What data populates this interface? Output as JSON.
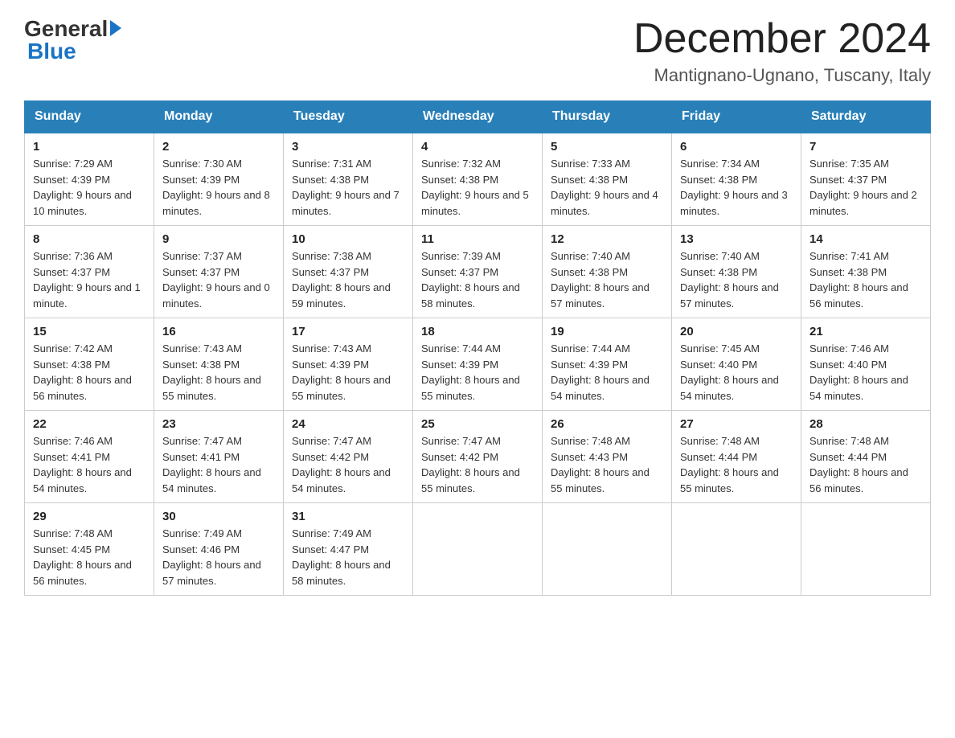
{
  "logo": {
    "general": "General",
    "blue": "Blue"
  },
  "title": "December 2024",
  "location": "Mantignano-Ugnano, Tuscany, Italy",
  "days_of_week": [
    "Sunday",
    "Monday",
    "Tuesday",
    "Wednesday",
    "Thursday",
    "Friday",
    "Saturday"
  ],
  "weeks": [
    [
      {
        "day": "1",
        "sunrise": "7:29 AM",
        "sunset": "4:39 PM",
        "daylight": "9 hours and 10 minutes."
      },
      {
        "day": "2",
        "sunrise": "7:30 AM",
        "sunset": "4:39 PM",
        "daylight": "9 hours and 8 minutes."
      },
      {
        "day": "3",
        "sunrise": "7:31 AM",
        "sunset": "4:38 PM",
        "daylight": "9 hours and 7 minutes."
      },
      {
        "day": "4",
        "sunrise": "7:32 AM",
        "sunset": "4:38 PM",
        "daylight": "9 hours and 5 minutes."
      },
      {
        "day": "5",
        "sunrise": "7:33 AM",
        "sunset": "4:38 PM",
        "daylight": "9 hours and 4 minutes."
      },
      {
        "day": "6",
        "sunrise": "7:34 AM",
        "sunset": "4:38 PM",
        "daylight": "9 hours and 3 minutes."
      },
      {
        "day": "7",
        "sunrise": "7:35 AM",
        "sunset": "4:37 PM",
        "daylight": "9 hours and 2 minutes."
      }
    ],
    [
      {
        "day": "8",
        "sunrise": "7:36 AM",
        "sunset": "4:37 PM",
        "daylight": "9 hours and 1 minute."
      },
      {
        "day": "9",
        "sunrise": "7:37 AM",
        "sunset": "4:37 PM",
        "daylight": "9 hours and 0 minutes."
      },
      {
        "day": "10",
        "sunrise": "7:38 AM",
        "sunset": "4:37 PM",
        "daylight": "8 hours and 59 minutes."
      },
      {
        "day": "11",
        "sunrise": "7:39 AM",
        "sunset": "4:37 PM",
        "daylight": "8 hours and 58 minutes."
      },
      {
        "day": "12",
        "sunrise": "7:40 AM",
        "sunset": "4:38 PM",
        "daylight": "8 hours and 57 minutes."
      },
      {
        "day": "13",
        "sunrise": "7:40 AM",
        "sunset": "4:38 PM",
        "daylight": "8 hours and 57 minutes."
      },
      {
        "day": "14",
        "sunrise": "7:41 AM",
        "sunset": "4:38 PM",
        "daylight": "8 hours and 56 minutes."
      }
    ],
    [
      {
        "day": "15",
        "sunrise": "7:42 AM",
        "sunset": "4:38 PM",
        "daylight": "8 hours and 56 minutes."
      },
      {
        "day": "16",
        "sunrise": "7:43 AM",
        "sunset": "4:38 PM",
        "daylight": "8 hours and 55 minutes."
      },
      {
        "day": "17",
        "sunrise": "7:43 AM",
        "sunset": "4:39 PM",
        "daylight": "8 hours and 55 minutes."
      },
      {
        "day": "18",
        "sunrise": "7:44 AM",
        "sunset": "4:39 PM",
        "daylight": "8 hours and 55 minutes."
      },
      {
        "day": "19",
        "sunrise": "7:44 AM",
        "sunset": "4:39 PM",
        "daylight": "8 hours and 54 minutes."
      },
      {
        "day": "20",
        "sunrise": "7:45 AM",
        "sunset": "4:40 PM",
        "daylight": "8 hours and 54 minutes."
      },
      {
        "day": "21",
        "sunrise": "7:46 AM",
        "sunset": "4:40 PM",
        "daylight": "8 hours and 54 minutes."
      }
    ],
    [
      {
        "day": "22",
        "sunrise": "7:46 AM",
        "sunset": "4:41 PM",
        "daylight": "8 hours and 54 minutes."
      },
      {
        "day": "23",
        "sunrise": "7:47 AM",
        "sunset": "4:41 PM",
        "daylight": "8 hours and 54 minutes."
      },
      {
        "day": "24",
        "sunrise": "7:47 AM",
        "sunset": "4:42 PM",
        "daylight": "8 hours and 54 minutes."
      },
      {
        "day": "25",
        "sunrise": "7:47 AM",
        "sunset": "4:42 PM",
        "daylight": "8 hours and 55 minutes."
      },
      {
        "day": "26",
        "sunrise": "7:48 AM",
        "sunset": "4:43 PM",
        "daylight": "8 hours and 55 minutes."
      },
      {
        "day": "27",
        "sunrise": "7:48 AM",
        "sunset": "4:44 PM",
        "daylight": "8 hours and 55 minutes."
      },
      {
        "day": "28",
        "sunrise": "7:48 AM",
        "sunset": "4:44 PM",
        "daylight": "8 hours and 56 minutes."
      }
    ],
    [
      {
        "day": "29",
        "sunrise": "7:48 AM",
        "sunset": "4:45 PM",
        "daylight": "8 hours and 56 minutes."
      },
      {
        "day": "30",
        "sunrise": "7:49 AM",
        "sunset": "4:46 PM",
        "daylight": "8 hours and 57 minutes."
      },
      {
        "day": "31",
        "sunrise": "7:49 AM",
        "sunset": "4:47 PM",
        "daylight": "8 hours and 58 minutes."
      },
      null,
      null,
      null,
      null
    ]
  ],
  "labels": {
    "sunrise": "Sunrise:",
    "sunset": "Sunset:",
    "daylight": "Daylight:"
  }
}
